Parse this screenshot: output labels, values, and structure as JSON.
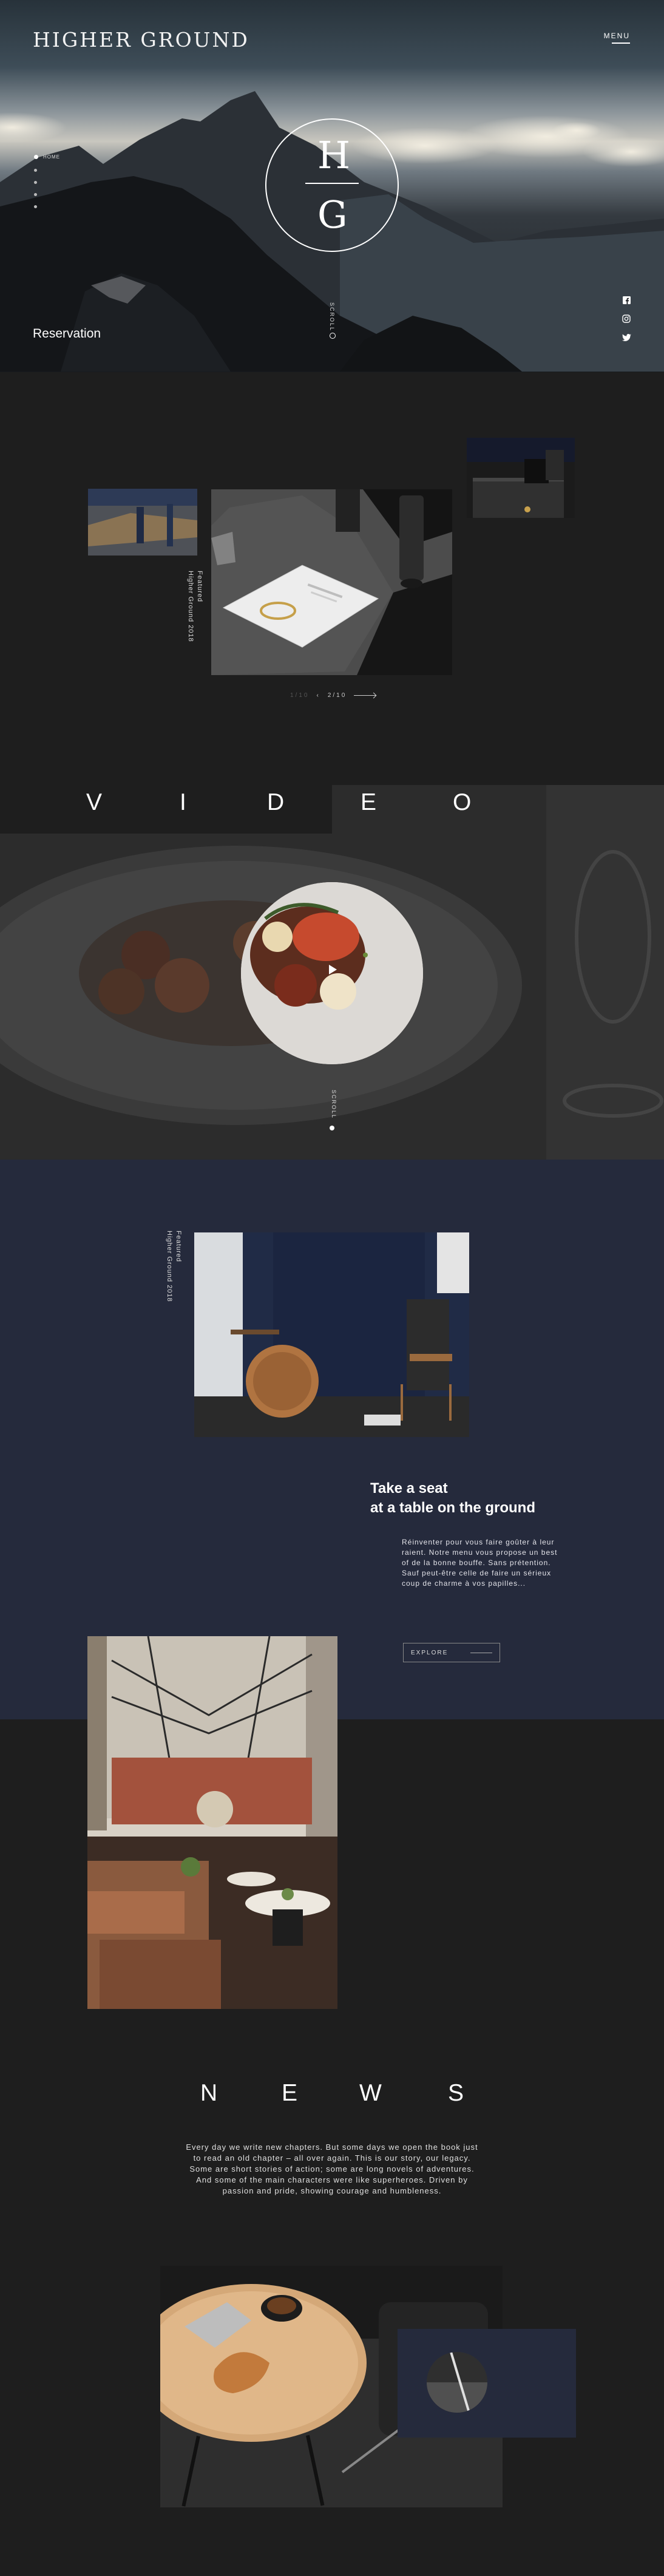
{
  "header": {
    "logo": "HIGHER GROUND",
    "menu_label": "MENU"
  },
  "hero": {
    "emblem_letters": [
      "H",
      "G"
    ],
    "side_nav": [
      "HOME",
      "",
      "",
      "",
      ""
    ],
    "reservation": "Reservation",
    "scroll_label": "SCROLL",
    "social": [
      "facebook-icon",
      "instagram-icon",
      "twitter-icon"
    ]
  },
  "gallery": {
    "caption": [
      "Featured",
      "Higher Ground 2018"
    ],
    "pager_prev": "1/10",
    "pager_current": "2/10"
  },
  "video": {
    "title": [
      "V",
      "I",
      "D",
      "E",
      "O"
    ],
    "scroll_label": "SCROLL"
  },
  "seat": {
    "caption": [
      "Featured",
      "Higher Ground 2018"
    ],
    "title_line1": "Take a seat",
    "title_line2": "at a table on the ground",
    "body": "Réinventer pour vous faire goûter à leur raient. Notre menu vous propose un best of de la bonne bouffe. Sans prétention. Sauf peut-être celle de faire un sérieux coup de charme à vos papilles...",
    "button_label": "EXPLORE"
  },
  "news": {
    "title": [
      "N",
      "E",
      "W",
      "S"
    ],
    "body": "Every day we write new chapters. But some days we open the book just to read an old chapter – all over again. This is our story, our legacy. Some are short stories of action; some are long novels of adventures. And some of the main characters were like superheroes. Driven by passion and pride, showing courage and humbleness."
  },
  "colors": {
    "page_bg": "#1e1e1e",
    "navy_bg": "#252a3c",
    "text": "#ffffff"
  }
}
